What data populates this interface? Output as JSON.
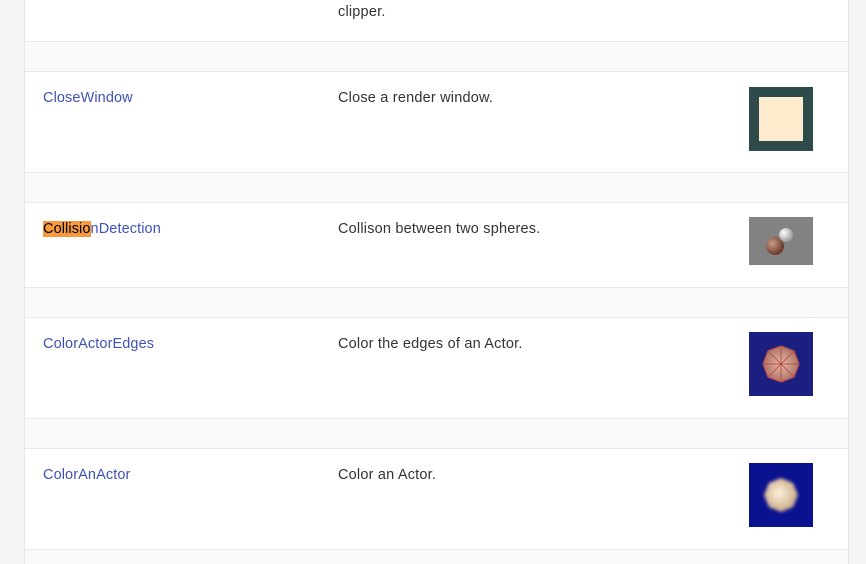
{
  "top_fragment": {
    "desc": "clipper."
  },
  "rows": [
    {
      "link": "CloseWindow",
      "desc": "Close a render window.",
      "image_icon": "close-window-thumbnail"
    },
    {
      "link_highlight": "Collisio",
      "link_rest": "nDetection",
      "desc": "Collison between two spheres.",
      "image_icon": "collision-detection-thumbnail"
    },
    {
      "link": "ColorActorEdges",
      "desc": "Color the edges of an Actor.",
      "image_icon": "color-actor-edges-thumbnail"
    },
    {
      "link": "ColorAnActor",
      "desc": "Color an Actor.",
      "image_icon": "color-an-actor-thumbnail"
    }
  ],
  "colors": {
    "link": "#3f51b5",
    "highlight": "#f79a3e",
    "text": "#333333"
  }
}
